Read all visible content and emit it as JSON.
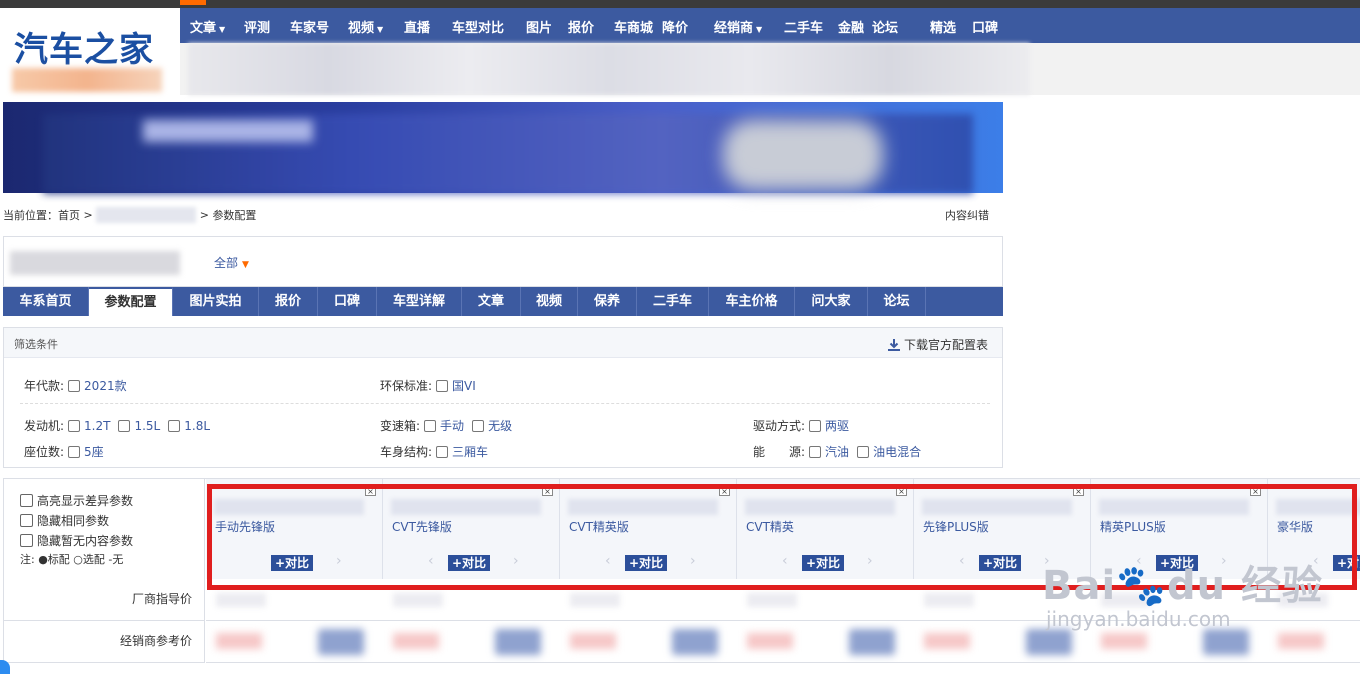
{
  "logo": {
    "text": "汽车之家"
  },
  "main_nav": [
    {
      "label": "文章",
      "dropdown": true
    },
    {
      "label": "评测",
      "dropdown": false
    },
    {
      "label": "车家号",
      "dropdown": false
    },
    {
      "label": "视频",
      "dropdown": true
    },
    {
      "label": "直播",
      "dropdown": false
    },
    {
      "label": "车型对比",
      "dropdown": false
    },
    {
      "label": "图片",
      "dropdown": false
    },
    {
      "label": "报价",
      "dropdown": false
    },
    {
      "label": "车商城",
      "dropdown": false
    },
    {
      "label": "降价",
      "dropdown": false
    },
    {
      "label": "经销商",
      "dropdown": true
    },
    {
      "label": "二手车",
      "dropdown": false
    },
    {
      "label": "金融",
      "dropdown": false
    },
    {
      "label": "论坛",
      "dropdown": false
    },
    {
      "label": "精选",
      "dropdown": false
    },
    {
      "label": "口碑",
      "dropdown": false
    }
  ],
  "breadcrumb": {
    "prefix": "当前位置：",
    "home": "首页",
    "sep1": ">",
    "sep2": ">",
    "current": "参数配置"
  },
  "correct_link": "内容纠错",
  "series_selector": {
    "all_label": "全部"
  },
  "tabs": [
    {
      "label": "车系首页",
      "active": false
    },
    {
      "label": "参数配置",
      "active": true
    },
    {
      "label": "图片实拍",
      "active": false
    },
    {
      "label": "报价",
      "active": false
    },
    {
      "label": "口碑",
      "active": false
    },
    {
      "label": "车型详解",
      "active": false
    },
    {
      "label": "文章",
      "active": false
    },
    {
      "label": "视频",
      "active": false
    },
    {
      "label": "保养",
      "active": false
    },
    {
      "label": "二手车",
      "active": false
    },
    {
      "label": "车主价格",
      "active": false
    },
    {
      "label": "问大家",
      "active": false
    },
    {
      "label": "论坛",
      "active": false
    }
  ],
  "filter": {
    "title": "筛选条件",
    "download_label": "下载官方配置表",
    "groups": {
      "year": {
        "label": "年代款:",
        "options": [
          "2021款"
        ]
      },
      "emission": {
        "label": "环保标准:",
        "options": [
          "国VI"
        ]
      },
      "engine": {
        "label": "发动机:",
        "options": [
          "1.2T",
          "1.5L",
          "1.8L"
        ]
      },
      "gearbox": {
        "label": "变速箱:",
        "options": [
          "手动",
          "无级"
        ]
      },
      "drive": {
        "label": "驱动方式:",
        "options": [
          "两驱"
        ]
      },
      "seats": {
        "label": "座位数:",
        "options": [
          "5座"
        ]
      },
      "body": {
        "label": "车身结构:",
        "options": [
          "三厢车"
        ]
      },
      "energy": {
        "label": "能　　源:",
        "options": [
          "汽油",
          "油电混合"
        ]
      }
    }
  },
  "compare_options": {
    "highlight_diff": "高亮显示差异参数",
    "hide_same": "隐藏相同参数",
    "hide_empty": "隐藏暂无内容参数",
    "legend": "注: ●标配 ○选配 -无"
  },
  "cars": [
    {
      "trim": "手动先锋版",
      "compare_label": "+对比"
    },
    {
      "trim": "CVT先锋版",
      "compare_label": "+对比"
    },
    {
      "trim": "CVT精英版",
      "compare_label": "+对比"
    },
    {
      "trim": "CVT精英",
      "compare_label": "+对比"
    },
    {
      "trim": "先锋PLUS版",
      "compare_label": "+对比"
    },
    {
      "trim": "精英PLUS版",
      "compare_label": "+对比"
    },
    {
      "trim": "豪华版",
      "compare_label": "+对比"
    }
  ],
  "rows": {
    "msrp_label": "厂商指导价",
    "dealer_label": "经销商参考价"
  },
  "watermark": {
    "main": "Bai",
    "paw": "du",
    "jingyan": "经验",
    "url": "jingyan.baidu.com"
  },
  "colors": {
    "nav_blue": "#3c5aa0",
    "highlight_red": "#e01e1e",
    "accent_orange": "#ff6a00"
  }
}
